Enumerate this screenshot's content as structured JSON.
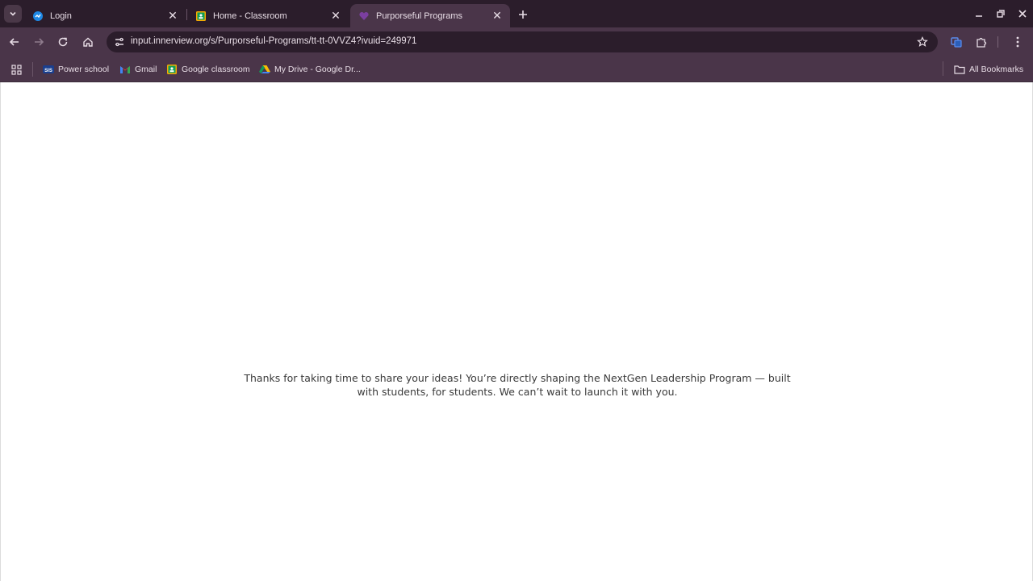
{
  "tabs": [
    {
      "label": "Login",
      "active": false
    },
    {
      "label": "Home - Classroom",
      "active": false
    },
    {
      "label": "Purporseful Programs",
      "active": true
    }
  ],
  "toolbar": {
    "url": "input.innerview.org/s/Purporseful-Programs/tt-tt-0VVZ4?ivuid=249971"
  },
  "bookmarks": {
    "items": [
      {
        "label": "Power school",
        "icon": "sis-icon"
      },
      {
        "label": "Gmail",
        "icon": "gmail-icon"
      },
      {
        "label": "Google classroom",
        "icon": "classroom-icon"
      },
      {
        "label": "My Drive - Google Dr...",
        "icon": "drive-icon"
      }
    ],
    "all_bookmarks": "All Bookmarks"
  },
  "page": {
    "message": "Thanks for taking  time to share your ideas! You’re directly shaping the NextGen Leadership Program — built with students, for students. We can’t wait to launch it with you."
  },
  "colors": {
    "frame": "#2b1d2b",
    "toolbar": "#4a3549",
    "text": "#e8dde6"
  }
}
